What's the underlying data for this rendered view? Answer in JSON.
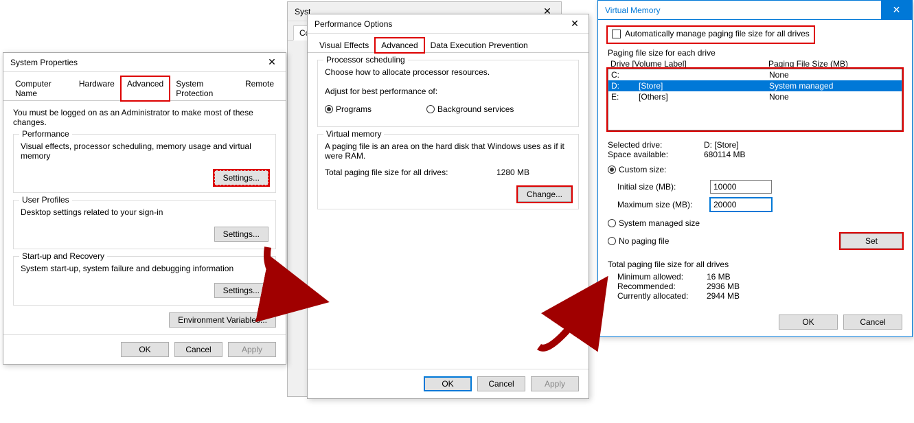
{
  "sysProps": {
    "title": "System Properties",
    "tabs": [
      "Computer Name",
      "Hardware",
      "Advanced",
      "System Protection",
      "Remote"
    ],
    "activeTab": "Advanced",
    "adminNote": "You must be logged on as an Administrator to make most of these changes.",
    "perf": {
      "title": "Performance",
      "desc": "Visual effects, processor scheduling, memory usage and virtual memory",
      "btn": "Settings..."
    },
    "profiles": {
      "title": "User Profiles",
      "desc": "Desktop settings related to your sign-in",
      "btn": "Settings..."
    },
    "startup": {
      "title": "Start-up and Recovery",
      "desc": "System start-up, system failure and debugging information",
      "btn": "Settings..."
    },
    "envBtn": "Environment Variables...",
    "ok": "OK",
    "cancel": "Cancel",
    "apply": "Apply"
  },
  "perfOpts": {
    "title": "Performance Options",
    "tabs": [
      "Visual Effects",
      "Advanced",
      "Data Execution Prevention"
    ],
    "activeTab": "Advanced",
    "sched": {
      "title": "Processor scheduling",
      "desc": "Choose how to allocate processor resources.",
      "adjust": "Adjust for best performance of:",
      "opt1": "Programs",
      "opt2": "Background services"
    },
    "vm": {
      "title": "Virtual memory",
      "desc": "A paging file is an area on the hard disk that Windows uses as if it were RAM.",
      "totalLabel": "Total paging file size for all drives:",
      "totalValue": "1280 MB",
      "btn": "Change..."
    },
    "ok": "OK",
    "cancel": "Cancel",
    "apply": "Apply"
  },
  "vmDialog": {
    "title": "Virtual Memory",
    "autoChk": "Automatically manage paging file size for all drives",
    "drivesTitle": "Paging file size for each drive",
    "hdrDrive": "Drive  [Volume Label]",
    "hdrSize": "Paging File Size (MB)",
    "drives": [
      {
        "letter": "C:",
        "label": "",
        "size": "None"
      },
      {
        "letter": "D:",
        "label": "[Store]",
        "size": "System managed"
      },
      {
        "letter": "E:",
        "label": "[Others]",
        "size": "None"
      }
    ],
    "selDriveLabel": "Selected drive:",
    "selDriveValue": "D:  [Store]",
    "spaceLabel": "Space available:",
    "spaceValue": "680114 MB",
    "custom": "Custom size:",
    "initLabel": "Initial size (MB):",
    "initValue": "10000",
    "maxLabel": "Maximum size (MB):",
    "maxValue": "20000",
    "sysManaged": "System managed size",
    "noPaging": "No paging file",
    "setBtn": "Set",
    "totalTitle": "Total paging file size for all drives",
    "minLabel": "Minimum allowed:",
    "minValue": "16 MB",
    "recLabel": "Recommended:",
    "recValue": "2936 MB",
    "curLabel": "Currently allocated:",
    "curValue": "2944 MB",
    "ok": "OK",
    "cancel": "Cancel"
  },
  "bgTab": "Com"
}
